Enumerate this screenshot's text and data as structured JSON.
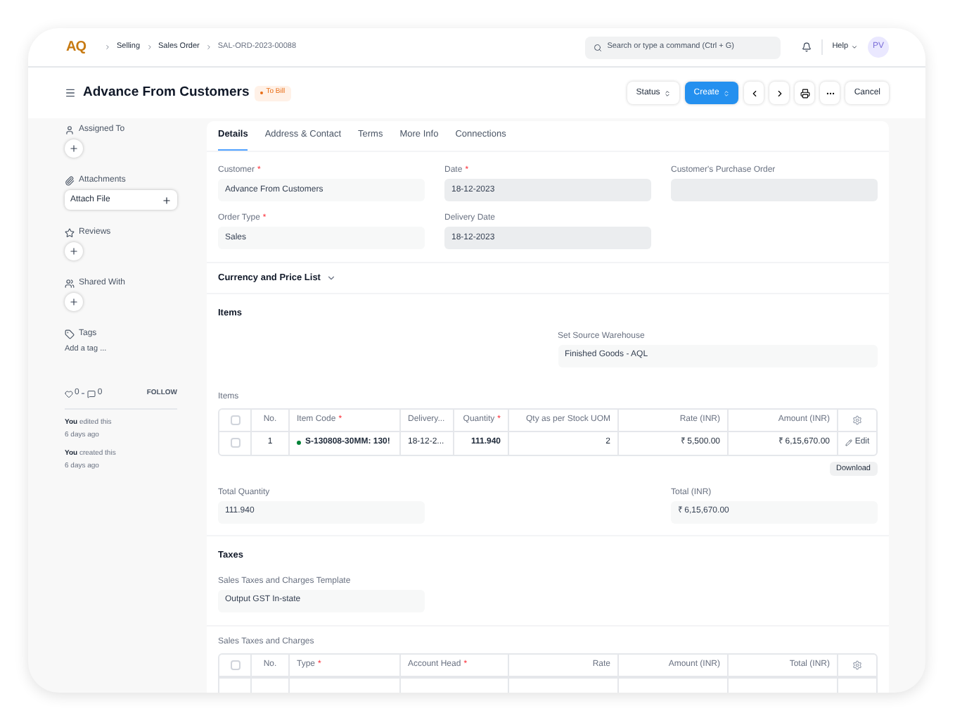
{
  "navbar": {
    "logo": "AQ",
    "breadcrumbs": [
      "Selling",
      "Sales Order",
      "SAL-ORD-2023-00088"
    ],
    "search": {
      "placeholder": "Search or type a command (Ctrl + G)"
    },
    "help": "Help",
    "avatar": "PV"
  },
  "header": {
    "title": "Advance From Customers",
    "status": {
      "label": "To Bill",
      "color": "#e86c13"
    },
    "buttons": [
      {
        "kind": "dropdown",
        "label": "Status"
      },
      {
        "kind": "primary",
        "label": "Create"
      },
      {
        "kind": "prev"
      },
      {
        "kind": "next"
      },
      {
        "kind": "print"
      },
      {
        "kind": "more"
      },
      {
        "kind": "plain",
        "label": "Cancel"
      }
    ]
  },
  "sidebar": {
    "sections": [
      {
        "kind": "assign",
        "title": "Assigned To"
      },
      {
        "kind": "attach",
        "title": "Attachments",
        "button": "Attach File"
      },
      {
        "kind": "review",
        "title": "Reviews"
      },
      {
        "kind": "share",
        "title": "Shared With"
      },
      {
        "kind": "tags",
        "title": "Tags",
        "link": "Add a tag ..."
      }
    ],
    "likes": "0",
    "comments": "0",
    "follow": "FOLLOW",
    "activity": [
      {
        "text": "**You** edited this",
        "time": "6 days ago"
      },
      {
        "text": "**You** created this",
        "time": "6 days ago"
      }
    ]
  },
  "tabs": [
    {
      "label": "Details",
      "selected": true
    },
    {
      "label": "Address & Contact",
      "selected": false
    },
    {
      "label": "Terms",
      "selected": false
    },
    {
      "label": "More Info",
      "selected": false
    },
    {
      "label": "Connections",
      "selected": false
    }
  ],
  "fields": [
    {
      "label": "Customer",
      "required_mark": "*",
      "value": "Advance From Customers",
      "readonly": false
    },
    {
      "label": "Date",
      "required_mark": "*",
      "value": "18-12-2023",
      "readonly": true
    },
    {
      "label": "Customer's Purchase Order",
      "readonly": true
    },
    {
      "label": "Order Type",
      "required_mark": "*",
      "value": "Sales",
      "readonly": false
    },
    {
      "label": "Delivery Date",
      "value": "18-12-2023",
      "readonly": true
    }
  ],
  "currency_section": {
    "title": "Currency and Price List",
    "expanded": false
  },
  "items_section": {
    "title": "Items",
    "warehouse": {
      "label": "Set Source Warehouse",
      "value": "Finished Goods - AQL"
    },
    "table": {
      "label": "Items",
      "header_checked": false,
      "columns": [
        {
          "label": "No."
        },
        {
          "label": "Item Code",
          "required_mark": "*"
        },
        {
          "label": "Delivery..."
        },
        {
          "label": "Quantity",
          "required_mark": "*"
        },
        {
          "label": "Qty as per Stock UOM"
        },
        {
          "label": "Rate (INR)"
        },
        {
          "label": "Amount (INR)"
        }
      ],
      "rows": [
        {
          "checked": false,
          "cells": [
            "1",
            "S-130808-30MM: 130!",
            "18-12-2...",
            "111.940",
            "2",
            "₹ 5,500.00",
            "₹ 6,15,670.00"
          ],
          "edit": "Edit"
        }
      ]
    },
    "download": "Download",
    "total_quantity": {
      "label": "Total Quantity",
      "value": "111.940"
    },
    "total": {
      "label": "Total (INR)",
      "value": "₹ 6,15,670.00"
    }
  },
  "taxes_section": {
    "title": "Taxes",
    "template": {
      "label": "Sales Taxes and Charges Template",
      "value": "Output GST In-state"
    },
    "table": {
      "label": "Sales Taxes and Charges",
      "header_checked": false,
      "columns": [
        {
          "label": "No."
        },
        {
          "label": "Type",
          "required_mark": "*"
        },
        {
          "label": "Account Head",
          "required_mark": "*"
        },
        {
          "label": "Rate"
        },
        {
          "label": "Amount (INR)"
        },
        {
          "label": "Total (INR)"
        }
      ]
    }
  }
}
